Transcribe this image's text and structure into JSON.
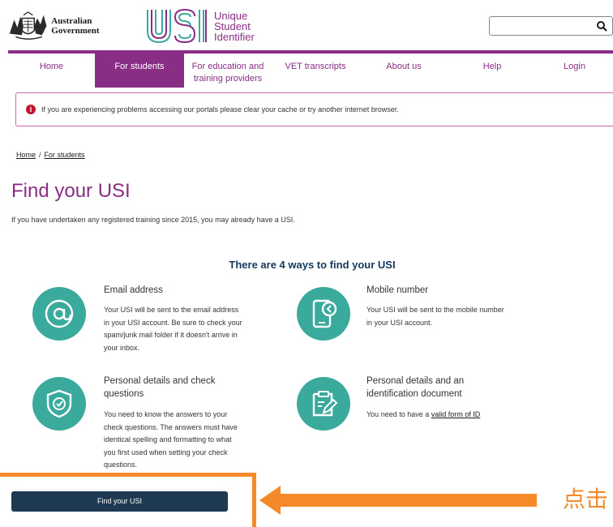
{
  "header": {
    "gov_name": "Australian Government",
    "usi_line1": "Unique",
    "usi_line2": "Student",
    "usi_line3": "Identifier",
    "search_placeholder": ""
  },
  "nav": {
    "items": [
      {
        "label": "Home"
      },
      {
        "label": "For students"
      },
      {
        "label_line1": "For education and",
        "label_line2": "training providers"
      },
      {
        "label": "VET transcripts"
      },
      {
        "label": "About us"
      },
      {
        "label": "Help"
      },
      {
        "label": "Login"
      }
    ]
  },
  "alert": {
    "text": "If you are experiencing problems accessing our portals please clear your cache or try another internet browser."
  },
  "breadcrumb": {
    "home": "Home",
    "separator": "/",
    "current": "For students"
  },
  "page": {
    "title": "Find your USI",
    "intro": "If you have undertaken any registered training since 2015, you may already have a USI."
  },
  "ways": {
    "heading": "There are 4 ways to find your USI",
    "email": {
      "title": "Email address",
      "desc": [
        "Your USI will be sent to the email address",
        "in your USI account. Be sure to check your",
        "spam/junk mail folder if it doesn't arrive in",
        "your inbox."
      ]
    },
    "mobile": {
      "title": "Mobile number",
      "desc": [
        "Your USI will be sent to the mobile number",
        "in your USI account."
      ]
    },
    "questions": {
      "title": [
        "Personal details and check",
        "questions"
      ],
      "desc": [
        "You need to know the answers to your",
        "check questions. The answers must have",
        "identical spelling and formatting to what",
        "you first used when setting your check",
        "questions."
      ]
    },
    "id_doc": {
      "title": [
        "Personal details and an",
        "identification document"
      ],
      "desc_prefix": "You need to have a ",
      "desc_link": "valid form of ID"
    }
  },
  "find_button": {
    "label": "Find your USI"
  },
  "annotation": {
    "text": "点击",
    "color": "#f58a2a"
  },
  "colors": {
    "brand_purple": "#8a2d84",
    "teal": "#3aaa9c",
    "navy": "#14395b",
    "button": "#1e3a52",
    "alert_red": "#c0162e"
  }
}
